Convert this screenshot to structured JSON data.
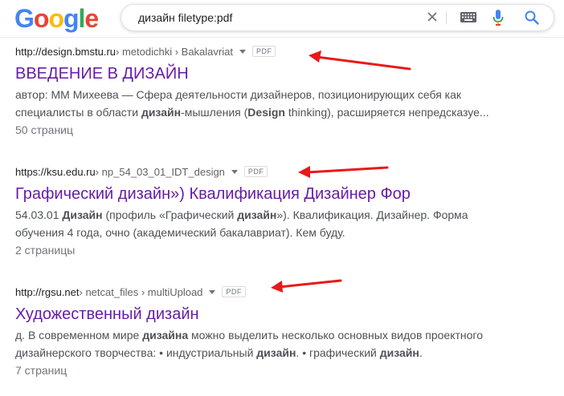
{
  "logo": {
    "text": "Google",
    "letters": [
      "G",
      "o",
      "o",
      "g",
      "l",
      "e"
    ],
    "colors": [
      "#4285f4",
      "#ea4335",
      "#fbbc05",
      "#4285f4",
      "#34a853",
      "#ea4335"
    ]
  },
  "search": {
    "query": "дизайн filetype:pdf",
    "icons": [
      "close-icon",
      "keyboard-icon",
      "microphone-icon",
      "search-icon"
    ]
  },
  "results": [
    {
      "domain": "http://design.bmstu.ru",
      "path": " › metodichki › Bakalavriat",
      "badge": "PDF",
      "title": "ВВЕДЕНИЕ В ДИЗАЙН",
      "snippet_line1": [
        {
          "t": "автор: ММ Михеева — Сфера деятельности дизайнеров, позиционирующих себя как",
          "b": false
        }
      ],
      "snippet_line2": [
        {
          "t": "специалисты в области ",
          "b": false
        },
        {
          "t": "дизайн",
          "b": true
        },
        {
          "t": "-мышления (",
          "b": false
        },
        {
          "t": "Design",
          "b": true
        },
        {
          "t": " thinking), расширяется непредсказуе...",
          "b": false
        }
      ],
      "pages": "50 страниц"
    },
    {
      "domain": "https://ksu.edu.ru",
      "path": " › np_54_03_01_IDT_design",
      "badge": "PDF",
      "title": "Графический дизайн») Квалификация Дизайнер Фор",
      "snippet_line1": [
        {
          "t": "54.03.01 ",
          "b": false
        },
        {
          "t": "Дизайн",
          "b": true
        },
        {
          "t": " (профиль «Графический ",
          "b": false
        },
        {
          "t": "дизайн",
          "b": true
        },
        {
          "t": "»). Квалификация. Дизайнер. Форма",
          "b": false
        }
      ],
      "snippet_line2": [
        {
          "t": "обучения 4 года, очно (академический бакалавриат). Кем буду.",
          "b": false
        }
      ],
      "pages": "2 страницы"
    },
    {
      "domain": "http://rgsu.net",
      "path": " › netcat_files › multiUpload",
      "badge": "PDF",
      "title": "Художественный дизайн",
      "snippet_line1": [
        {
          "t": "д. В современном мире ",
          "b": false
        },
        {
          "t": "дизайна",
          "b": true
        },
        {
          "t": " можно выделить несколько основных видов проектного",
          "b": false
        }
      ],
      "snippet_line2": [
        {
          "t": "дизайнерского творчества: • индустриальный ",
          "b": false
        },
        {
          "t": "дизайн",
          "b": true
        },
        {
          "t": ". • графический ",
          "b": false
        },
        {
          "t": "дизайн",
          "b": true
        },
        {
          "t": ".",
          "b": false
        }
      ],
      "pages": "7 страниц"
    }
  ],
  "annotation_color": "#e8191b"
}
